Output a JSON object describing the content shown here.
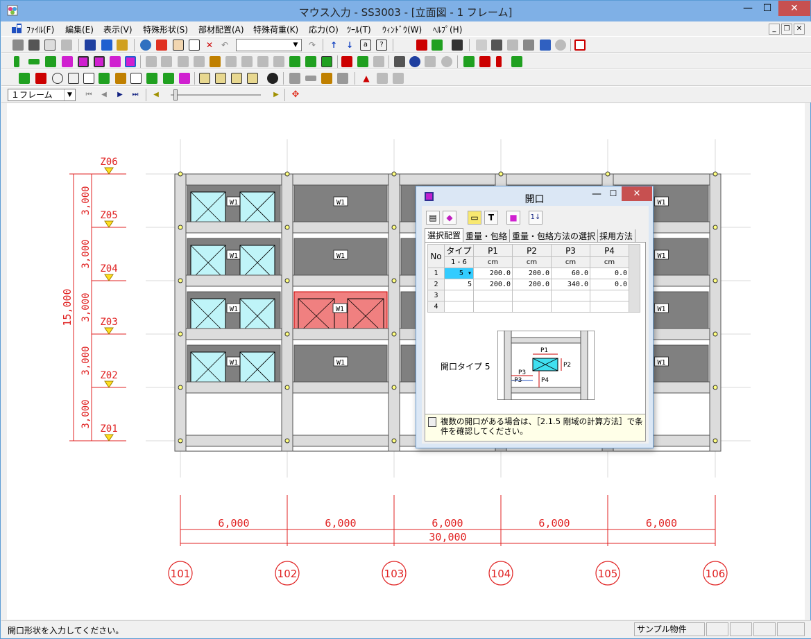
{
  "window": {
    "title": "マウス入力 - SS3003 - [立面図 - 1 フレーム]",
    "min_glyph": "—",
    "max_glyph": "☐",
    "close_glyph": "✕"
  },
  "menu": {
    "items": [
      "ﾌｧｲﾙ(F)",
      "編集(E)",
      "表示(V)",
      "特殊形状(S)",
      "部材配置(A)",
      "特殊荷重(K)",
      "応力(O)",
      "ﾂｰﾙ(T)",
      "ｳｨﾝﾄﾞｳ(W)",
      "ﾍﾙﾌﾟ(H)"
    ],
    "mdi_min": "_",
    "mdi_restore": "❐",
    "mdi_close": "✕"
  },
  "toolbar": {
    "frame_select_value": "１フレーム",
    "dropdown_glyph": "▼"
  },
  "drawing": {
    "levels": [
      "Z06",
      "Z05",
      "Z04",
      "Z03",
      "Z02",
      "Z01"
    ],
    "story_heights": [
      "3,000",
      "3,000",
      "3,000",
      "3,000",
      "3,000"
    ],
    "total_height": "15,000",
    "spans": [
      "6,000",
      "6,000",
      "6,000",
      "6,000",
      "6,000"
    ],
    "total_span": "30,000",
    "axes": [
      "101",
      "102",
      "103",
      "104",
      "105",
      "106"
    ],
    "wall_label": "W1"
  },
  "dialog": {
    "title": "開口",
    "min_glyph": "—",
    "max_glyph": "☐",
    "close_glyph": "✕",
    "tabs": [
      "選択配置",
      "重量・包絡",
      "重量・包絡方法の選択",
      "採用方法"
    ],
    "grid": {
      "headers": [
        "No",
        "タイプ",
        "P1",
        "P2",
        "P3",
        "P4"
      ],
      "subheaders": [
        "1 - 6",
        "cm",
        "cm",
        "cm",
        "cm"
      ],
      "rows": [
        {
          "no": "1",
          "type": "5",
          "p1": "200.0",
          "p2": "200.0",
          "p3": "60.0",
          "p4": "0.0"
        },
        {
          "no": "2",
          "type": "5",
          "p1": "200.0",
          "p2": "200.0",
          "p3": "340.0",
          "p4": "0.0"
        },
        {
          "no": "3",
          "type": "",
          "p1": "",
          "p2": "",
          "p3": "",
          "p4": ""
        },
        {
          "no": "4",
          "type": "",
          "p1": "",
          "p2": "",
          "p3": "",
          "p4": ""
        }
      ]
    },
    "opening_type_label": "開口タイプ 5",
    "diagram_labels": {
      "p1": "P1",
      "p2": "P2",
      "p3": "P3",
      "p3b": "-P3",
      "p4": "P4"
    },
    "note": "複数の開口がある場合は、［2.1.5 剛域の計算方法］で条件を確認してください。"
  },
  "status": {
    "text": "開口形状を入力してください。",
    "project": "サンプル物件"
  }
}
